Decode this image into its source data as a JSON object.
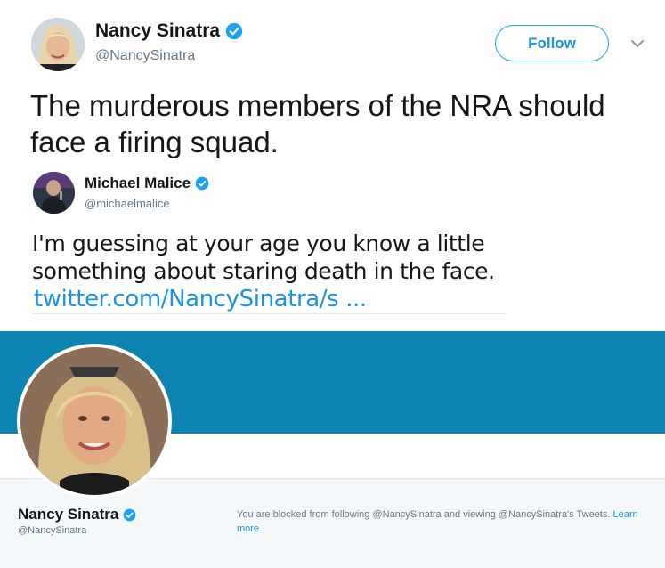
{
  "tweet": {
    "author_name": "Nancy Sinatra",
    "author_handle": "@NancySinatra",
    "follow_label": "Follow",
    "text": "The murderous members of the NRA should face a firing squad."
  },
  "reply": {
    "author_name": "Michael Malice",
    "author_handle": "@michaelmalice",
    "text": "I'm guessing at your age you know a little something about staring death in the face.",
    "link_text": "twitter.com/NancySinatra/s ..."
  },
  "profile": {
    "name": "Nancy Sinatra",
    "handle": "@NancySinatra",
    "blocked_message": "You are blocked from following @NancySinatra and viewing @NancySinatra's Tweets.",
    "learn_more_label": "Learn more"
  },
  "icons": {
    "verified": "verified-badge-icon",
    "dropdown": "chevron-down-icon"
  },
  "colors": {
    "twitter_blue": "#1da1f2",
    "link_blue": "#1b95e0",
    "banner_blue": "#0d84b2",
    "text_dark": "#14171a",
    "text_gray": "#657786"
  }
}
